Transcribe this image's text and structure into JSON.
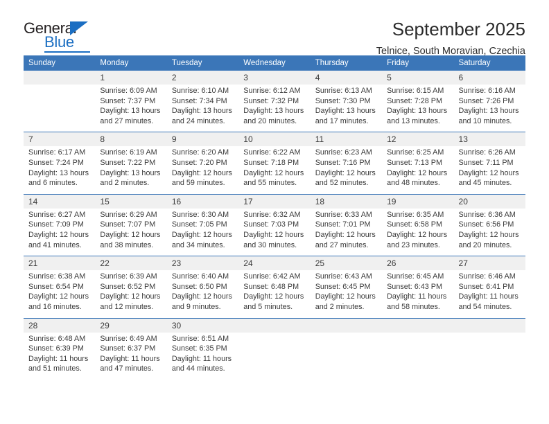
{
  "logo": {
    "word_one": "General",
    "word_two": "Blue",
    "triangle_icon": "blue-triangle-icon",
    "accent_color": "#1b6ec2"
  },
  "header": {
    "title": "September 2025",
    "subtitle": "Telnice, South Moravian, Czechia"
  },
  "calendar": {
    "header_bg": "#3b76b8",
    "daynum_bg": "#f0f0f0",
    "weekday_headers": [
      "Sunday",
      "Monday",
      "Tuesday",
      "Wednesday",
      "Thursday",
      "Friday",
      "Saturday"
    ],
    "weeks": [
      [
        {
          "day": "",
          "lines": []
        },
        {
          "day": "1",
          "lines": [
            "Sunrise: 6:09 AM",
            "Sunset: 7:37 PM",
            "Daylight: 13 hours",
            "and 27 minutes."
          ]
        },
        {
          "day": "2",
          "lines": [
            "Sunrise: 6:10 AM",
            "Sunset: 7:34 PM",
            "Daylight: 13 hours",
            "and 24 minutes."
          ]
        },
        {
          "day": "3",
          "lines": [
            "Sunrise: 6:12 AM",
            "Sunset: 7:32 PM",
            "Daylight: 13 hours",
            "and 20 minutes."
          ]
        },
        {
          "day": "4",
          "lines": [
            "Sunrise: 6:13 AM",
            "Sunset: 7:30 PM",
            "Daylight: 13 hours",
            "and 17 minutes."
          ]
        },
        {
          "day": "5",
          "lines": [
            "Sunrise: 6:15 AM",
            "Sunset: 7:28 PM",
            "Daylight: 13 hours",
            "and 13 minutes."
          ]
        },
        {
          "day": "6",
          "lines": [
            "Sunrise: 6:16 AM",
            "Sunset: 7:26 PM",
            "Daylight: 13 hours",
            "and 10 minutes."
          ]
        }
      ],
      [
        {
          "day": "7",
          "lines": [
            "Sunrise: 6:17 AM",
            "Sunset: 7:24 PM",
            "Daylight: 13 hours",
            "and 6 minutes."
          ]
        },
        {
          "day": "8",
          "lines": [
            "Sunrise: 6:19 AM",
            "Sunset: 7:22 PM",
            "Daylight: 13 hours",
            "and 2 minutes."
          ]
        },
        {
          "day": "9",
          "lines": [
            "Sunrise: 6:20 AM",
            "Sunset: 7:20 PM",
            "Daylight: 12 hours",
            "and 59 minutes."
          ]
        },
        {
          "day": "10",
          "lines": [
            "Sunrise: 6:22 AM",
            "Sunset: 7:18 PM",
            "Daylight: 12 hours",
            "and 55 minutes."
          ]
        },
        {
          "day": "11",
          "lines": [
            "Sunrise: 6:23 AM",
            "Sunset: 7:16 PM",
            "Daylight: 12 hours",
            "and 52 minutes."
          ]
        },
        {
          "day": "12",
          "lines": [
            "Sunrise: 6:25 AM",
            "Sunset: 7:13 PM",
            "Daylight: 12 hours",
            "and 48 minutes."
          ]
        },
        {
          "day": "13",
          "lines": [
            "Sunrise: 6:26 AM",
            "Sunset: 7:11 PM",
            "Daylight: 12 hours",
            "and 45 minutes."
          ]
        }
      ],
      [
        {
          "day": "14",
          "lines": [
            "Sunrise: 6:27 AM",
            "Sunset: 7:09 PM",
            "Daylight: 12 hours",
            "and 41 minutes."
          ]
        },
        {
          "day": "15",
          "lines": [
            "Sunrise: 6:29 AM",
            "Sunset: 7:07 PM",
            "Daylight: 12 hours",
            "and 38 minutes."
          ]
        },
        {
          "day": "16",
          "lines": [
            "Sunrise: 6:30 AM",
            "Sunset: 7:05 PM",
            "Daylight: 12 hours",
            "and 34 minutes."
          ]
        },
        {
          "day": "17",
          "lines": [
            "Sunrise: 6:32 AM",
            "Sunset: 7:03 PM",
            "Daylight: 12 hours",
            "and 30 minutes."
          ]
        },
        {
          "day": "18",
          "lines": [
            "Sunrise: 6:33 AM",
            "Sunset: 7:01 PM",
            "Daylight: 12 hours",
            "and 27 minutes."
          ]
        },
        {
          "day": "19",
          "lines": [
            "Sunrise: 6:35 AM",
            "Sunset: 6:58 PM",
            "Daylight: 12 hours",
            "and 23 minutes."
          ]
        },
        {
          "day": "20",
          "lines": [
            "Sunrise: 6:36 AM",
            "Sunset: 6:56 PM",
            "Daylight: 12 hours",
            "and 20 minutes."
          ]
        }
      ],
      [
        {
          "day": "21",
          "lines": [
            "Sunrise: 6:38 AM",
            "Sunset: 6:54 PM",
            "Daylight: 12 hours",
            "and 16 minutes."
          ]
        },
        {
          "day": "22",
          "lines": [
            "Sunrise: 6:39 AM",
            "Sunset: 6:52 PM",
            "Daylight: 12 hours",
            "and 12 minutes."
          ]
        },
        {
          "day": "23",
          "lines": [
            "Sunrise: 6:40 AM",
            "Sunset: 6:50 PM",
            "Daylight: 12 hours",
            "and 9 minutes."
          ]
        },
        {
          "day": "24",
          "lines": [
            "Sunrise: 6:42 AM",
            "Sunset: 6:48 PM",
            "Daylight: 12 hours",
            "and 5 minutes."
          ]
        },
        {
          "day": "25",
          "lines": [
            "Sunrise: 6:43 AM",
            "Sunset: 6:45 PM",
            "Daylight: 12 hours",
            "and 2 minutes."
          ]
        },
        {
          "day": "26",
          "lines": [
            "Sunrise: 6:45 AM",
            "Sunset: 6:43 PM",
            "Daylight: 11 hours",
            "and 58 minutes."
          ]
        },
        {
          "day": "27",
          "lines": [
            "Sunrise: 6:46 AM",
            "Sunset: 6:41 PM",
            "Daylight: 11 hours",
            "and 54 minutes."
          ]
        }
      ],
      [
        {
          "day": "28",
          "lines": [
            "Sunrise: 6:48 AM",
            "Sunset: 6:39 PM",
            "Daylight: 11 hours",
            "and 51 minutes."
          ]
        },
        {
          "day": "29",
          "lines": [
            "Sunrise: 6:49 AM",
            "Sunset: 6:37 PM",
            "Daylight: 11 hours",
            "and 47 minutes."
          ]
        },
        {
          "day": "30",
          "lines": [
            "Sunrise: 6:51 AM",
            "Sunset: 6:35 PM",
            "Daylight: 11 hours",
            "and 44 minutes."
          ]
        },
        {
          "day": "",
          "lines": []
        },
        {
          "day": "",
          "lines": []
        },
        {
          "day": "",
          "lines": []
        },
        {
          "day": "",
          "lines": []
        }
      ]
    ]
  }
}
